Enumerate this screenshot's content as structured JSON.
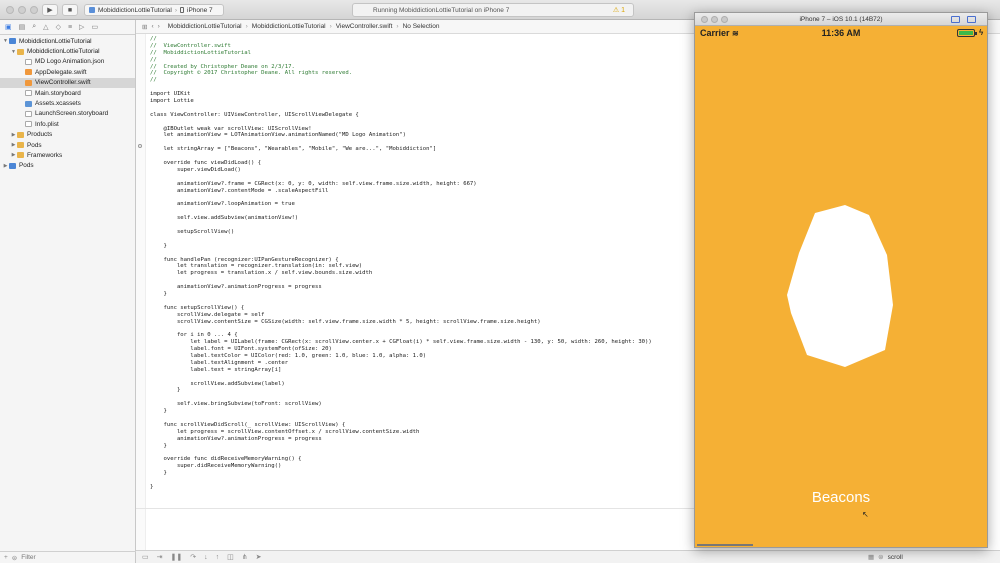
{
  "toolbar": {
    "scheme_project": "MobiddictionLottieTutorial",
    "scheme_device": "iPhone 7",
    "activity_status": "Running MobiddictionLottieTutorial on iPhone 7",
    "warning_count": "1"
  },
  "navigator": {
    "items": [
      {
        "label": "MobiddictionLottieTutorial",
        "indent": 0,
        "disclosure": "open",
        "icon": "project",
        "selected": false
      },
      {
        "label": "MobiddictionLottieTutorial",
        "indent": 1,
        "disclosure": "open",
        "icon": "folder",
        "selected": false
      },
      {
        "label": "MD Logo Animation.json",
        "indent": 2,
        "disclosure": "none",
        "icon": "json",
        "selected": false
      },
      {
        "label": "AppDelegate.swift",
        "indent": 2,
        "disclosure": "none",
        "icon": "swift",
        "selected": false
      },
      {
        "label": "ViewController.swift",
        "indent": 2,
        "disclosure": "none",
        "icon": "swift",
        "selected": true
      },
      {
        "label": "Main.storyboard",
        "indent": 2,
        "disclosure": "none",
        "icon": "sb",
        "selected": false
      },
      {
        "label": "Assets.xcassets",
        "indent": 2,
        "disclosure": "none",
        "icon": "assets",
        "selected": false
      },
      {
        "label": "LaunchScreen.storyboard",
        "indent": 2,
        "disclosure": "none",
        "icon": "sb",
        "selected": false
      },
      {
        "label": "Info.plist",
        "indent": 2,
        "disclosure": "none",
        "icon": "plist",
        "selected": false
      },
      {
        "label": "Products",
        "indent": 1,
        "disclosure": "closed",
        "icon": "folder",
        "selected": false
      },
      {
        "label": "Pods",
        "indent": 1,
        "disclosure": "closed",
        "icon": "folder",
        "selected": false
      },
      {
        "label": "Frameworks",
        "indent": 1,
        "disclosure": "closed",
        "icon": "folder",
        "selected": false
      },
      {
        "label": "Pods",
        "indent": 0,
        "disclosure": "closed",
        "icon": "project",
        "selected": false
      }
    ],
    "filter_placeholder": "Filter"
  },
  "jumpbar": {
    "crumbs": [
      "MobiddictionLottieTutorial",
      "MobiddictionLottieTutorial",
      "ViewController.swift",
      "No Selection"
    ]
  },
  "code": [
    {
      "t": "//",
      "k": "c"
    },
    {
      "t": "//  ViewController.swift",
      "k": "c"
    },
    {
      "t": "//  MobiddictionLottieTutorial",
      "k": "c"
    },
    {
      "t": "//",
      "k": "c"
    },
    {
      "t": "//  Created by Christopher Deane on 2/3/17.",
      "k": "c"
    },
    {
      "t": "//  Copyright © 2017 Christopher Deane. All rights reserved.",
      "k": "c"
    },
    {
      "t": "//",
      "k": "c"
    },
    {
      "t": "",
      "k": ""
    },
    {
      "t": "import UIKit",
      "k": ""
    },
    {
      "t": "import Lottie",
      "k": ""
    },
    {
      "t": "",
      "k": ""
    },
    {
      "t": "class ViewController: UIViewController, UIScrollViewDelegate {",
      "k": ""
    },
    {
      "t": "",
      "k": ""
    },
    {
      "t": "    @IBOutlet weak var scrollView: UIScrollView!",
      "k": ""
    },
    {
      "t": "    let animationView = LOTAnimationView.animationNamed(\"MD Logo Animation\")",
      "k": ""
    },
    {
      "t": "",
      "k": ""
    },
    {
      "t": "    let stringArray = [\"Beacons\", \"Wearables\", \"Mobile\", \"We are...\", \"Mobiddiction\"]",
      "k": ""
    },
    {
      "t": "",
      "k": ""
    },
    {
      "t": "    override func viewDidLoad() {",
      "k": ""
    },
    {
      "t": "        super.viewDidLoad()",
      "k": ""
    },
    {
      "t": "",
      "k": ""
    },
    {
      "t": "        animationView?.frame = CGRect(x: 0, y: 0, width: self.view.frame.size.width, height: 667)",
      "k": ""
    },
    {
      "t": "        animationView?.contentMode = .scaleAspectFill",
      "k": ""
    },
    {
      "t": "",
      "k": ""
    },
    {
      "t": "        animationView?.loopAnimation = true",
      "k": ""
    },
    {
      "t": "",
      "k": ""
    },
    {
      "t": "        self.view.addSubview(animationView!)",
      "k": ""
    },
    {
      "t": "",
      "k": ""
    },
    {
      "t": "        setupScrollView()",
      "k": ""
    },
    {
      "t": "",
      "k": ""
    },
    {
      "t": "    }",
      "k": ""
    },
    {
      "t": "",
      "k": ""
    },
    {
      "t": "    func handlePan (recognizer:UIPanGestureRecognizer) {",
      "k": ""
    },
    {
      "t": "        let translation = recognizer.translation(in: self.view)",
      "k": ""
    },
    {
      "t": "        let progress = translation.x / self.view.bounds.size.width",
      "k": ""
    },
    {
      "t": "",
      "k": ""
    },
    {
      "t": "        animationView?.animationProgress = progress",
      "k": ""
    },
    {
      "t": "    }",
      "k": ""
    },
    {
      "t": "",
      "k": ""
    },
    {
      "t": "    func setupScrollView() {",
      "k": ""
    },
    {
      "t": "        scrollView.delegate = self",
      "k": ""
    },
    {
      "t": "        scrollView.contentSize = CGSize(width: self.view.frame.size.width * 5, height: scrollView.frame.size.height)",
      "k": ""
    },
    {
      "t": "",
      "k": ""
    },
    {
      "t": "        for i in 0 ... 4 {",
      "k": ""
    },
    {
      "t": "            let label = UILabel(frame: CGRect(x: scrollView.center.x + CGFloat(i) * self.view.frame.size.width - 130, y: 50, width: 260, height: 30))",
      "k": ""
    },
    {
      "t": "            label.font = UIFont.systemFont(ofSize: 20)",
      "k": ""
    },
    {
      "t": "            label.textColor = UIColor(red: 1.0, green: 1.0, blue: 1.0, alpha: 1.0)",
      "k": ""
    },
    {
      "t": "            label.textAlignment = .center",
      "k": ""
    },
    {
      "t": "            label.text = stringArray[i]",
      "k": ""
    },
    {
      "t": "",
      "k": ""
    },
    {
      "t": "            scrollView.addSubview(label)",
      "k": ""
    },
    {
      "t": "        }",
      "k": ""
    },
    {
      "t": "",
      "k": ""
    },
    {
      "t": "        self.view.bringSubview(toFront: scrollView)",
      "k": ""
    },
    {
      "t": "    }",
      "k": ""
    },
    {
      "t": "",
      "k": ""
    },
    {
      "t": "    func scrollViewDidScroll(_ scrollView: UIScrollView) {",
      "k": ""
    },
    {
      "t": "        let progress = scrollView.contentOffset.x / scrollView.contentSize.width",
      "k": ""
    },
    {
      "t": "        animationView?.animationProgress = progress",
      "k": ""
    },
    {
      "t": "    }",
      "k": ""
    },
    {
      "t": "",
      "k": ""
    },
    {
      "t": "    override func didReceiveMemoryWarning() {",
      "k": ""
    },
    {
      "t": "        super.didReceiveMemoryWarning()",
      "k": ""
    },
    {
      "t": "    }",
      "k": ""
    },
    {
      "t": "",
      "k": ""
    },
    {
      "t": "}",
      "k": ""
    }
  ],
  "debug_area": {
    "variable_filter": "scroll"
  },
  "simulator": {
    "window_title": "iPhone 7 – iOS 10.1 (14B72)",
    "carrier": "Carrier",
    "time": "11:36 AM",
    "battery_level": 1.0,
    "caption": "Beacons",
    "background_color": "#f5b035",
    "blob_color": "#ffffff"
  }
}
